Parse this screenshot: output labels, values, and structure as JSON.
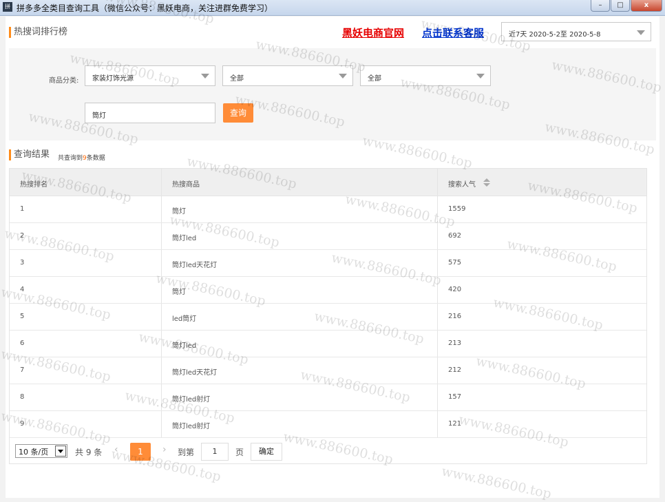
{
  "window": {
    "title": "拼多多全类目查询工具（微信公众号：黑妖电商，关注进群免费学习）",
    "icon_text": "拼",
    "min": "–",
    "max": "□",
    "close": "x"
  },
  "header": {
    "title": "热搜词排行榜",
    "link_official": "黑妖电商官网",
    "link_service": "点击联系客服",
    "date_range": "近7天 2020-5-2至 2020-5-8"
  },
  "filter": {
    "category_label": "商品分类:",
    "cat1": "家装灯饰光源",
    "cat2": "全部",
    "cat3": "全部",
    "keyword": "筒灯",
    "query_button": "查询"
  },
  "results": {
    "title": "查询结果",
    "summary_prefix": "共查询到",
    "count": "9",
    "summary_suffix": "条数据",
    "columns": [
      "热搜排名",
      "热搜商品",
      "搜索人气"
    ],
    "rows": [
      {
        "rank": "1",
        "product": "筒灯",
        "popularity": "1559"
      },
      {
        "rank": "2",
        "product": "筒灯led",
        "popularity": "692"
      },
      {
        "rank": "3",
        "product": "筒灯led天花灯",
        "popularity": "575"
      },
      {
        "rank": "4",
        "product": "筒灯",
        "popularity": "420"
      },
      {
        "rank": "5",
        "product": "led筒灯",
        "popularity": "216"
      },
      {
        "rank": "6",
        "product": "筒灯led",
        "popularity": "213"
      },
      {
        "rank": "7",
        "product": "筒灯led天花灯",
        "popularity": "212"
      },
      {
        "rank": "8",
        "product": "筒灯led射灯",
        "popularity": "157"
      },
      {
        "rank": "9",
        "product": "筒灯led射灯",
        "popularity": "121"
      }
    ]
  },
  "pagination": {
    "per_page": "10 条/页",
    "total": "共 9 条",
    "prev": "‹",
    "current_page": "1",
    "next": "›",
    "goto_label": "到第",
    "goto_value": "1",
    "page_unit": "页",
    "confirm": "确定"
  },
  "watermark": "www.886600.top",
  "colors": {
    "accent": "#ff8c38",
    "link_red": "#e60000",
    "link_blue": "#0033cc"
  }
}
